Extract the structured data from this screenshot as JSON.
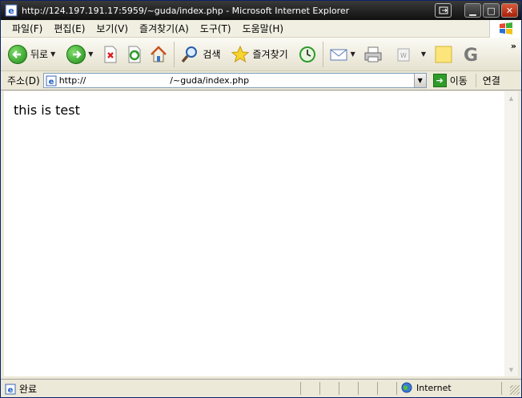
{
  "window": {
    "title": "http://124.197.191.17:5959/~guda/index.php - Microsoft Internet Explorer"
  },
  "menu": [
    {
      "label": "파일(F)",
      "name": "file"
    },
    {
      "label": "편집(E)",
      "name": "edit"
    },
    {
      "label": "보기(V)",
      "name": "view"
    },
    {
      "label": "즐겨찾기(A)",
      "name": "favorites"
    },
    {
      "label": "도구(T)",
      "name": "tools"
    },
    {
      "label": "도움말(H)",
      "name": "help"
    }
  ],
  "toolbar": {
    "back_label": "뒤로",
    "search_label": "검색",
    "favorites_label": "즐겨찾기",
    "overflow": "»"
  },
  "address": {
    "label": "주소(D)",
    "url_value": "http://                              /~guda/index.php",
    "go_label": "이동",
    "links_label": "연결"
  },
  "page": {
    "body_text": "this is test"
  },
  "status": {
    "text": "완료",
    "zone": "Internet"
  },
  "colors": {
    "titlebar": "#1a1a1a",
    "chrome": "#ece9d8",
    "accent_green": "#2e9b2a"
  }
}
